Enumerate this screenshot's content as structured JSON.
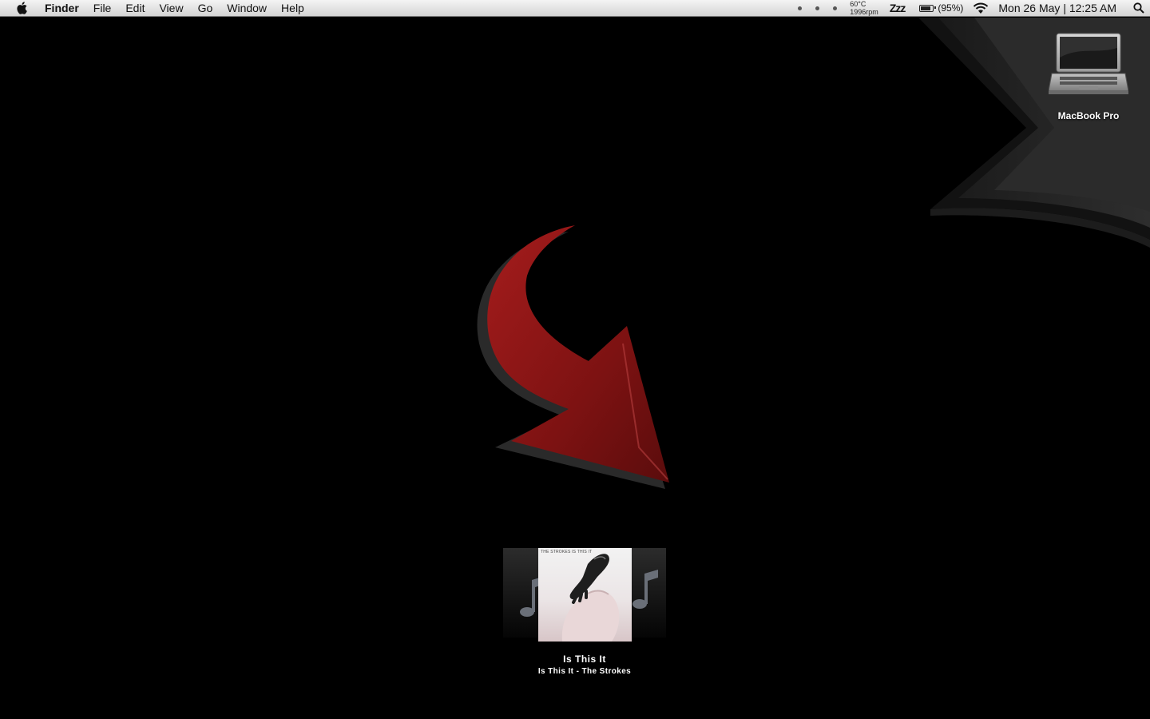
{
  "menubar": {
    "app_name": "Finder",
    "menus": [
      "File",
      "Edit",
      "View",
      "Go",
      "Window",
      "Help"
    ],
    "temperature": "60°C",
    "fan_speed": "1996rpm",
    "sleep_label": "Zzz",
    "battery_text": "(95%)",
    "battery_level": 0.95,
    "clock": "Mon 26 May | 12:25 AM"
  },
  "desktop": {
    "icons": [
      {
        "label": "MacBook Pro",
        "icon": "laptop-icon"
      }
    ]
  },
  "now_playing": {
    "title": "Is This It",
    "subtitle": "Is This It - The Strokes",
    "cover_text": "THE STROKES IS THIS IT"
  },
  "colors": {
    "arrow_red": "#8e1414",
    "wallpaper_gray": "#2a2a2a"
  }
}
